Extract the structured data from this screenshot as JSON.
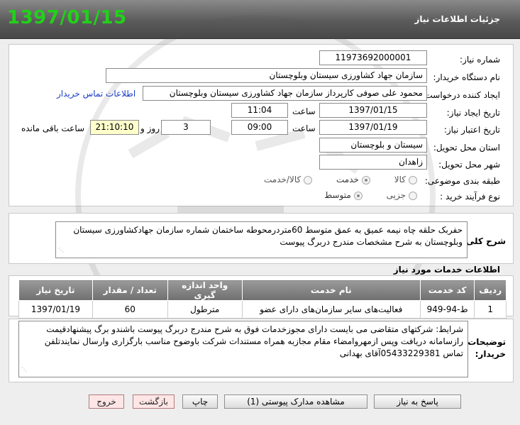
{
  "header": {
    "date": "1397/01/15",
    "title": "جزئیات اطلاعات نیاز"
  },
  "form": {
    "need_number_label": "شماره نیاز:",
    "need_number": "1197369200000​1",
    "buyer_org_label": "نام دستگاه خریدار:",
    "buyer_org": "سازمان جهاد کشاورزی سیستان وبلوچستان",
    "requester_label": "ایجاد کننده درخواست:",
    "requester": "محمود علی صوفی کارپرداز سازمان جهاد کشاورزی سیستان وبلوچستان",
    "contact_link": "اطلاعات تماس خریدار",
    "created_label": "تاریخ ایجاد نیاز:",
    "created_date": "1397/01/15",
    "time_label": "ساعت",
    "created_time": "11:04",
    "validity_label": "تاریخ اعتبار نیاز:",
    "validity_date": "1397/01/19",
    "validity_time": "09:00",
    "days_value": "3",
    "days_label": "روز و",
    "remaining_time": "21:10:10",
    "remaining_label": "ساعت باقی مانده",
    "province_label": "استان محل تحویل:",
    "province": "سیستان و بلوچستان",
    "city_label": "شهر محل تحویل:",
    "city": "زاهدان",
    "category_label": "طبقه بندی موضوعی:",
    "category_options": [
      "کالا",
      "خدمت",
      "کالا/خدمت"
    ],
    "category_selected": "خدمت",
    "process_label": "نوع فرآیند خرید :",
    "process_options": [
      "جزیی",
      "متوسط"
    ],
    "process_selected": "متوسط"
  },
  "description": {
    "label": "شرح کلی نیاز:",
    "text": "حفربک حلقه چاه نیمه عمیق به عمق متوسط 60متردرمحوطه ساختمان شماره سازمان جهادکشاورزی سیستان وبلوچستان به شرح مشخصات مندرج دربرگ پیوست"
  },
  "services": {
    "title": "اطلاعات خدمات مورد نیاز",
    "columns": [
      "ردیف",
      "کد خدمت",
      "نام خدمت",
      "واحد اندازه گیری",
      "تعداد / مقدار",
      "تاریخ نیاز"
    ],
    "rows": [
      [
        "1",
        "ط-94-949",
        "فعالیت‌های سایر سازمان‌های دارای عضو",
        "مترطول",
        "60",
        "1397/01/19"
      ]
    ]
  },
  "notes": {
    "label_line1": "توضیحات",
    "label_line2": "خریدار:",
    "text": "شرایط: شرکتهای متقاضی می بایست دارای مجوزخدمات فوق به شرح  مندرج دربرگ پیوست باشندو برگ پیشنهادقیمت رازسامانه دریافت وپس ازمهروامضاء مقام مجازبه همراه مستندات شرکت  باوضوح مناسب بارگزاری وارسال نمایندتلفن تماس 05433229381آقای بهدانی"
  },
  "buttons": {
    "reply": "پاسخ به نیاز",
    "attachments": "مشاهده مدارک پیوستی (1)",
    "print": "چاپ",
    "back": "بازگشت",
    "exit": "خروج"
  },
  "colors": {
    "header_date": "#22d11a",
    "header_bg": "#5b5b5b",
    "link": "#1a3dc8",
    "remaining_bg": "#ffffcc"
  }
}
